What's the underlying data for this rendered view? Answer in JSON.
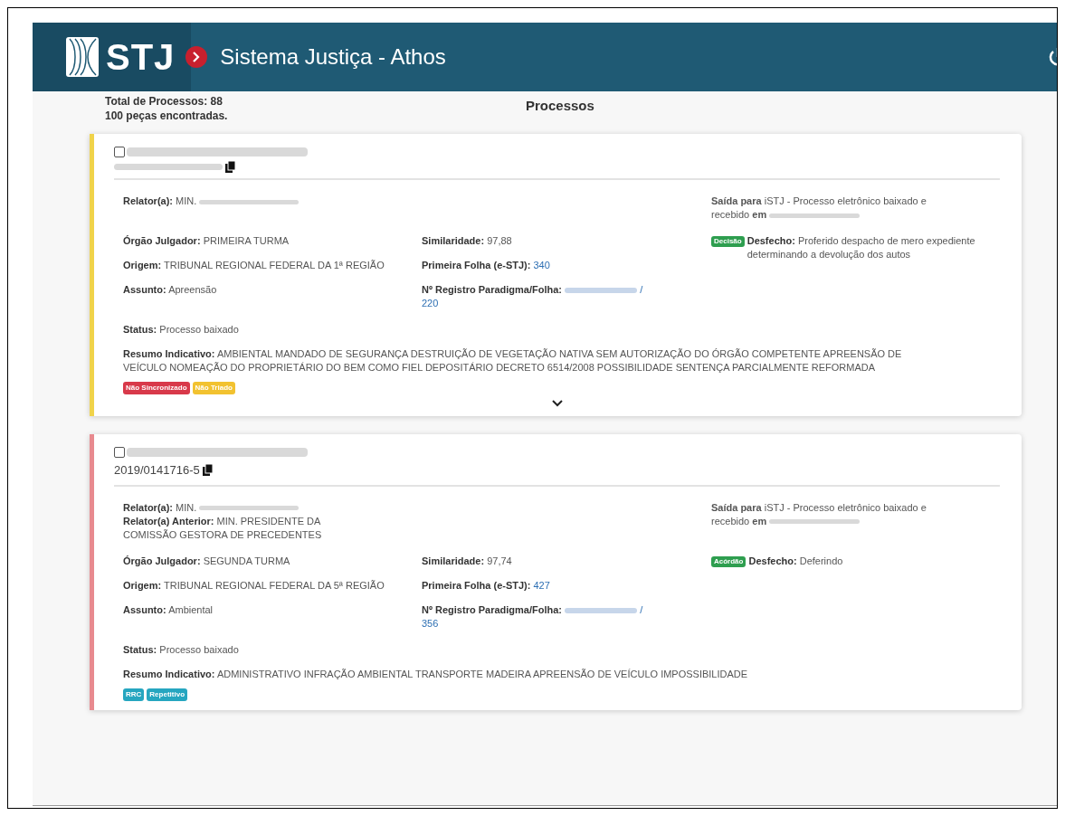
{
  "header": {
    "logo": "STJ",
    "title": "Sistema Justiça - Athos"
  },
  "summary": {
    "total": "Total de Processos: 88",
    "found": "100 peças encontradas.",
    "heading": "Processos"
  },
  "cards": [
    {
      "color": "#f0d34a",
      "title_redacted": true,
      "number_redacted": true,
      "relators": [
        {
          "label": "Relator(a):",
          "value": "MIN.",
          "redacted": true
        }
      ],
      "saida": {
        "text": "**Saída para** iSTJ - Processo eletrônico baixado e recebido **em**",
        "redacted": true
      },
      "left": [
        {
          "label": "Órgão Julgador:",
          "value": "PRIMEIRA TURMA"
        },
        {
          "label": "Origem:",
          "value": "TRIBUNAL REGIONAL FEDERAL DA 1ª REGIÃO"
        },
        {
          "label": "Assunto:",
          "value": "Apreensão"
        }
      ],
      "middle": [
        {
          "label": "Similaridade:",
          "value": "97,88",
          "link": false,
          "redacted": false
        },
        {
          "label": "Primeira Folha (e-STJ):",
          "value": "340",
          "link": true,
          "redacted": false
        },
        {
          "label": "Nº Registro Paradigma/Folha:",
          "value": "/ 220",
          "link": true,
          "redacted": true
        }
      ],
      "desfecho": {
        "badge": "Decisão",
        "label": "Desfecho:",
        "value": "Proferido despacho de mero expediente determinando a devolução dos autos"
      },
      "status": {
        "label": "Status:",
        "value": "Processo baixado"
      },
      "resumo": {
        "label": "Resumo Indicativo:",
        "value": "AMBIENTAL MANDADO DE SEGURANÇA DESTRUIÇÃO DE VEGETAÇÃO NATIVA SEM AUTORIZAÇÃO DO ÓRGÃO COMPETENTE APREENSÃO DE VEÍCULO NOMEAÇÃO DO PROPRIETÁRIO DO BEM COMO FIEL DEPOSITÁRIO DECRETO 6514/2008 POSSIBILIDADE SENTENÇA PARCIALMENTE REFORMADA"
      },
      "tags": [
        {
          "text": "Não Sincronizado",
          "color": "#d8394a"
        },
        {
          "text": "Não Triado",
          "color": "#f2c230"
        }
      ],
      "expand": true
    },
    {
      "color": "#e88a8f",
      "title_redacted": true,
      "number": "2019/0141716-5",
      "number_redacted": false,
      "relators": [
        {
          "label": "Relator(a):",
          "value": "MIN.",
          "redacted": true
        },
        {
          "label": "Relator(a) Anterior:",
          "value": "MIN. PRESIDENTE DA COMISSÃO GESTORA DE PRECEDENTES",
          "redacted": false
        }
      ],
      "saida": {
        "text": "**Saída para** iSTJ - Processo eletrônico baixado e recebido **em**",
        "redacted": true
      },
      "left": [
        {
          "label": "Órgão Julgador:",
          "value": "SEGUNDA TURMA"
        },
        {
          "label": "Origem:",
          "value": "TRIBUNAL REGIONAL FEDERAL DA 5ª REGIÃO"
        },
        {
          "label": "Assunto:",
          "value": "Ambiental"
        }
      ],
      "middle": [
        {
          "label": "Similaridade:",
          "value": "97,74",
          "link": false,
          "redacted": false
        },
        {
          "label": "Primeira Folha (e-STJ):",
          "value": "427",
          "link": true,
          "redacted": false
        },
        {
          "label": "Nº Registro Paradigma/Folha:",
          "value": "/ 356",
          "link": true,
          "redacted": true
        }
      ],
      "desfecho": {
        "badge": "Acórdão",
        "label": "Desfecho:",
        "value": "Deferindo"
      },
      "status": {
        "label": "Status:",
        "value": "Processo baixado"
      },
      "resumo": {
        "label": "Resumo Indicativo:",
        "value": "ADMINISTRATIVO INFRAÇÃO AMBIENTAL TRANSPORTE MADEIRA APREENSÃO DE VEÍCULO IMPOSSIBILIDADE"
      },
      "tags": [
        {
          "text": "RRC",
          "color": "#26a6c0"
        },
        {
          "text": "Repetitivo",
          "color": "#26a6c0"
        }
      ],
      "expand": false
    }
  ]
}
